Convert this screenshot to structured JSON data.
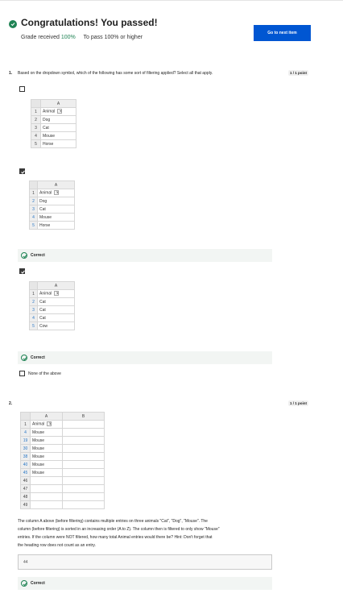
{
  "header": {
    "title": "Congratulations! You passed!",
    "grade_label": "Grade received",
    "grade_value": "100%",
    "pass_label": "To pass 100% or higher",
    "next_button": "Go to next item"
  },
  "q1": {
    "number": "1.",
    "text": "Based on the dropdown symbol, which of the following has some sort of filtering applied? Select all that apply.",
    "points": "1 / 1 point",
    "options": [
      {
        "checked": false,
        "col_label": "A",
        "rows": [
          {
            "num": "1",
            "value": "Animal",
            "filter": "dropdown"
          },
          {
            "num": "2",
            "value": "Dog"
          },
          {
            "num": "3",
            "value": "Cat"
          },
          {
            "num": "4",
            "value": "Mouse"
          },
          {
            "num": "5",
            "value": "Horse"
          }
        ]
      },
      {
        "checked": true,
        "col_label": "A",
        "rows": [
          {
            "num": "1",
            "value": "Animal",
            "filter": "filtered"
          },
          {
            "num": "2",
            "value": "Dog"
          },
          {
            "num": "3",
            "value": "Cat"
          },
          {
            "num": "4",
            "value": "Mouse"
          },
          {
            "num": "5",
            "value": "Horse"
          }
        ],
        "feedback": "Correct"
      },
      {
        "checked": true,
        "col_label": "A",
        "rows": [
          {
            "num": "1",
            "value": "Animal",
            "filter": "filtered"
          },
          {
            "num": "2",
            "value": "Cat"
          },
          {
            "num": "3",
            "value": "Cat"
          },
          {
            "num": "4",
            "value": "Cat"
          },
          {
            "num": "5",
            "value": "Cow"
          }
        ],
        "feedback": "Correct"
      },
      {
        "checked": false,
        "label": "None of the above"
      }
    ]
  },
  "q2": {
    "number": "2.",
    "points": "1 / 1 point",
    "col_a": "A",
    "col_b": "B",
    "rows": [
      {
        "num": "1",
        "value": "Animal",
        "filter": "filtered"
      },
      {
        "num": "4",
        "value": "Mouse"
      },
      {
        "num": "19",
        "value": "Mouse"
      },
      {
        "num": "30",
        "value": "Mouse"
      },
      {
        "num": "38",
        "value": "Mouse"
      },
      {
        "num": "40",
        "value": "Mouse"
      },
      {
        "num": "45",
        "value": "Mouse"
      },
      {
        "num": "46",
        "value": ""
      },
      {
        "num": "47",
        "value": ""
      },
      {
        "num": "48",
        "value": ""
      },
      {
        "num": "49",
        "value": ""
      }
    ],
    "text_lines": [
      "The column A above (before filtering) contains multiple entries on three animals \"Cat\", \"Dog\", \"Mouse\". The",
      "column (before filtering) is sorted in an increasing order (A to Z). The column then is filtered to only show \"Mouse\"",
      "entries. If the column were NOT filtered, how many total Animal entries would there be? Hint: Don't forget that",
      "the heading row does not count as an entry."
    ],
    "answer": "44",
    "feedback": "Correct"
  },
  "colors": {
    "primary": "#0056d2",
    "success": "#1f8354",
    "link_blue": "#2b78c6"
  }
}
